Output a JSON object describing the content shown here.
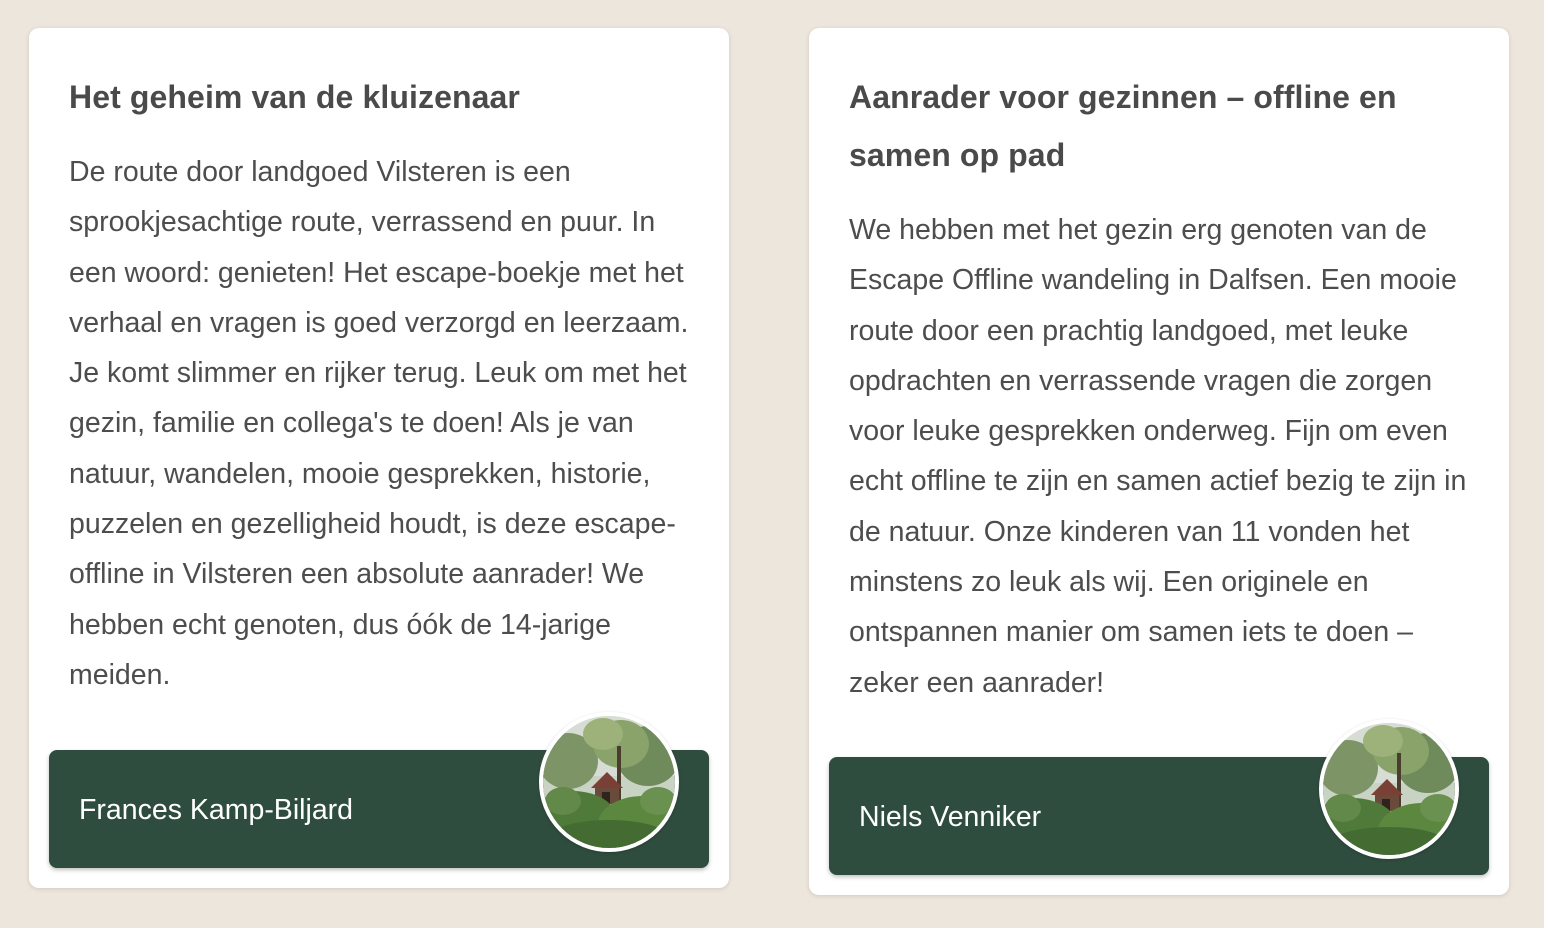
{
  "reviews": [
    {
      "title": "Het geheim van de kluizenaar",
      "body": "De route door landgoed Vilsteren is een sprookjesachtige route, verrassend en puur. In een woord: genieten! Het escape-boekje met het verhaal en vragen is goed verzorgd en leerzaam. Je komt slimmer en rijker terug. Leuk om met het gezin, familie en collega's te doen! Als je van natuur, wandelen, mooie gesprekken, historie, puzzelen en gezelligheid houdt, is deze escape-offline in Vilsteren een absolute aanrader! We hebben echt genoten, dus óók de 14-jarige meiden.",
      "author": "Frances Kamp-Biljard",
      "avatar_icon": "forest-cabin-photo"
    },
    {
      "title": "Aanrader voor gezinnen – offline en samen op pad",
      "body": "We hebben met het gezin erg genoten van de Escape Offline wandeling in Dalfsen. Een mooie route door een prachtig landgoed, met leuke opdrachten en verrassende vragen die zorgen voor leuke gesprekken onderweg. Fijn om even echt offline te zijn en samen actief bezig te zijn in de natuur. Onze kinderen van 11 vonden het minstens zo leuk als wij. Een originele en ontspannen manier om samen iets te doen – zeker een aanrader!",
      "author": "Niels Venniker",
      "avatar_icon": "forest-cabin-photo"
    }
  ],
  "colors": {
    "background": "#ede6dc",
    "card": "#ffffff",
    "author_bar": "#2f4d3e",
    "title_text": "#4a4a4a",
    "body_text": "#4d4d4d"
  }
}
